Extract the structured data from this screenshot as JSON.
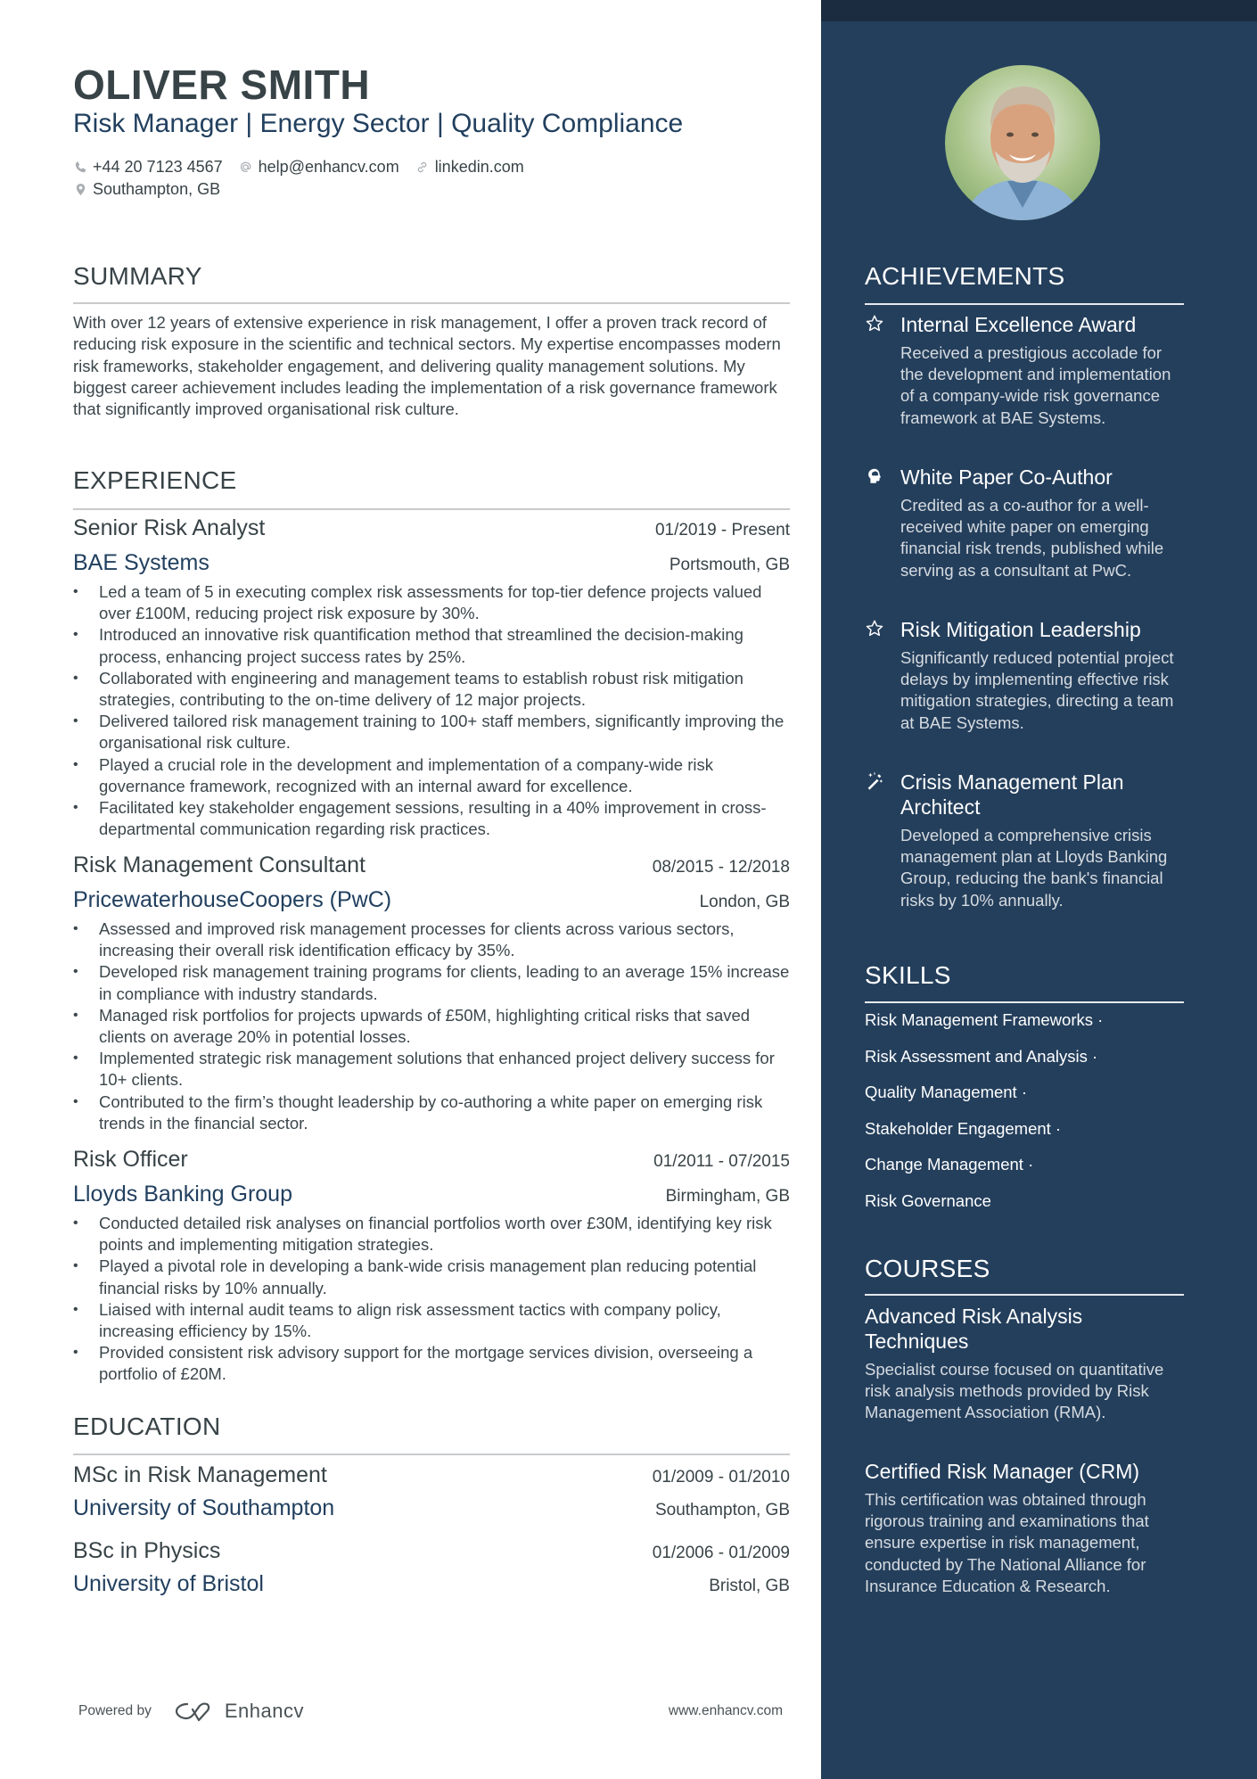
{
  "header": {
    "name": "OLIVER SMITH",
    "headline": "Risk Manager | Energy Sector | Quality Compliance",
    "contacts": {
      "phone": "+44 20 7123 4567",
      "email": "help@enhancv.com",
      "link": "linkedin.com",
      "location": "Southampton, GB"
    }
  },
  "summary": {
    "title": "SUMMARY",
    "text": "With over 12 years of extensive experience in risk management, I offer a proven track record of reducing risk exposure in the scientific and technical sectors. My expertise encompasses modern risk frameworks, stakeholder engagement, and delivering quality management solutions. My biggest career achievement includes leading the implementation of a risk governance framework that significantly improved organisational risk culture."
  },
  "experience": {
    "title": "EXPERIENCE",
    "jobs": [
      {
        "role": "Senior Risk Analyst",
        "dates": "01/2019 - Present",
        "company": "BAE Systems",
        "location": "Portsmouth, GB",
        "bullets": [
          "Led a team of 5 in executing complex risk assessments for top-tier defence projects valued over £100M, reducing project risk exposure by 30%.",
          "Introduced an innovative risk quantification method that streamlined the decision-making process, enhancing project success rates by 25%.",
          "Collaborated with engineering and management teams to establish robust risk mitigation strategies, contributing to the on-time delivery of 12 major projects.",
          "Delivered tailored risk management training to 100+ staff members, significantly improving the organisational risk culture.",
          "Played a crucial role in the development and implementation of a company-wide risk governance framework, recognized with an internal award for excellence.",
          "Facilitated key stakeholder engagement sessions, resulting in a 40% improvement in cross-departmental communication regarding risk practices."
        ]
      },
      {
        "role": "Risk Management Consultant",
        "dates": "08/2015 - 12/2018",
        "company": "PricewaterhouseCoopers (PwC)",
        "location": "London, GB",
        "bullets": [
          "Assessed and improved risk management processes for clients across various sectors, increasing their overall risk identification efficacy by 35%.",
          "Developed risk management training programs for clients, leading to an average 15% increase in compliance with industry standards.",
          "Managed risk portfolios for projects upwards of £50M, highlighting critical risks that saved clients on average 20% in potential losses.",
          "Implemented strategic risk management solutions that enhanced project delivery success for 10+ clients.",
          "Contributed to the firm’s thought leadership by co-authoring a white paper on emerging risk trends in the financial sector."
        ]
      },
      {
        "role": "Risk Officer",
        "dates": "01/2011 - 07/2015",
        "company": "Lloyds Banking Group",
        "location": "Birmingham, GB",
        "bullets": [
          "Conducted detailed risk analyses on financial portfolios worth over £30M, identifying key risk points and implementing mitigation strategies.",
          "Played a pivotal role in developing a bank-wide crisis management plan reducing potential financial risks by 10% annually.",
          "Liaised with internal audit teams to align risk assessment tactics with company policy, increasing efficiency by 15%.",
          "Provided consistent risk advisory support for the mortgage services division, overseeing a portfolio of £20M."
        ]
      }
    ]
  },
  "education": {
    "title": "EDUCATION",
    "items": [
      {
        "degree": "MSc in Risk Management",
        "dates": "01/2009 - 01/2010",
        "school": "University of Southampton",
        "location": "Southampton, GB"
      },
      {
        "degree": "BSc in Physics",
        "dates": "01/2006 - 01/2009",
        "school": "University of Bristol",
        "location": "Bristol, GB"
      }
    ]
  },
  "footer": {
    "powered_by": "Powered by",
    "brand": "Enhancv",
    "url": "www.enhancv.com"
  },
  "achievements": {
    "title": "ACHIEVEMENTS",
    "items": [
      {
        "icon": "star-icon",
        "title": "Internal Excellence Award",
        "desc": "Received a prestigious accolade for the development and implementation of a company-wide risk governance framework at BAE Systems."
      },
      {
        "icon": "brain-head-icon",
        "title": "White Paper Co-Author",
        "desc": "Credited as a co-author for a well-received white paper on emerging financial risk trends, published while serving as a consultant at PwC."
      },
      {
        "icon": "star-icon",
        "title": "Risk Mitigation Leadership",
        "desc": "Significantly reduced potential project delays by implementing effective risk mitigation strategies, directing a team at BAE Systems."
      },
      {
        "icon": "magic-wand-icon",
        "title": "Crisis Management Plan Architect",
        "desc": "Developed a comprehensive crisis management plan at Lloyds Banking Group, reducing the bank's financial risks by 10% annually."
      }
    ]
  },
  "skills": {
    "title": "SKILLS",
    "items": [
      "Risk Management Frameworks ·",
      "Risk Assessment and Analysis ·",
      "Quality Management ·",
      "Stakeholder Engagement ·",
      "Change Management ·",
      "Risk Governance"
    ]
  },
  "courses": {
    "title": "COURSES",
    "items": [
      {
        "title": "Advanced Risk Analysis Techniques",
        "desc": "Specialist course focused on quantitative risk analysis methods provided by Risk Management Association (RMA)."
      },
      {
        "title": "Certified Risk Manager (CRM)",
        "desc": "This certification was obtained through rigorous training and examinations that ensure expertise in risk management, conducted by The National Alliance for Insurance Education & Research."
      }
    ]
  },
  "colors": {
    "sidebar_bg": "#243f5c",
    "sidebar_band": "#1b2c40",
    "accent_blue": "#22405f",
    "text_dark": "#384347"
  }
}
